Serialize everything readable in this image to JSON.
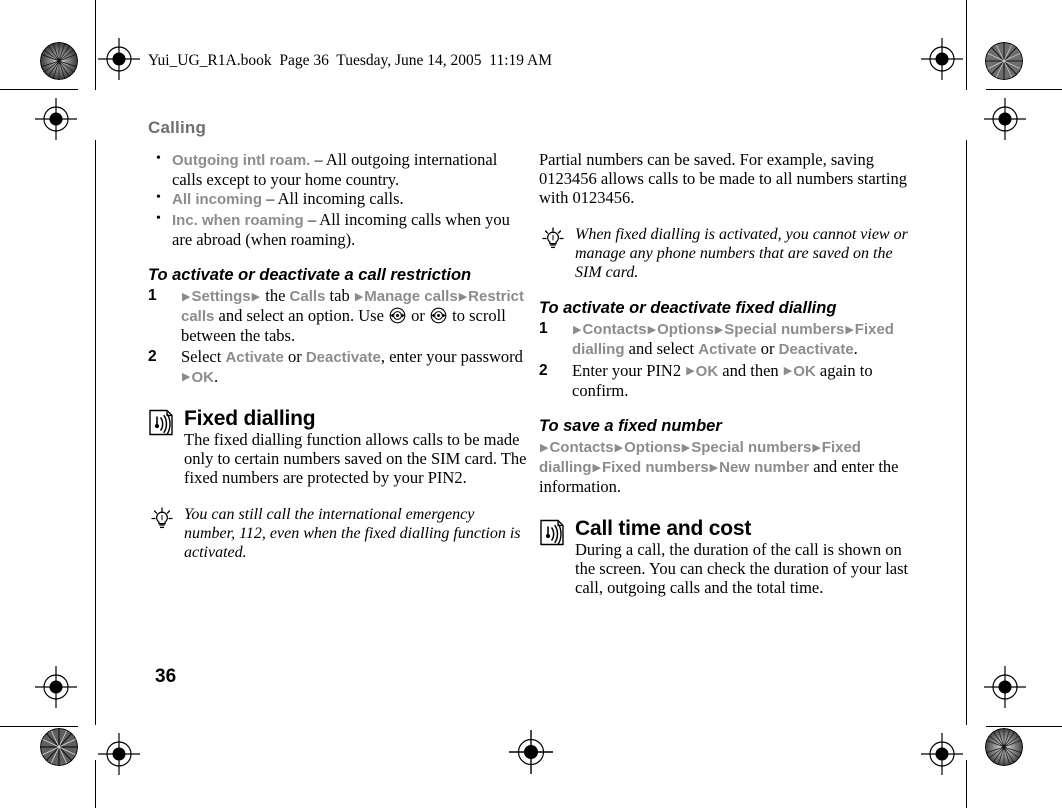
{
  "print": {
    "file_stamp": "Yui_UG_R1A.book  Page 36  Tuesday, June 14, 2005  11:19 AM",
    "folio": "36"
  },
  "chapter": {
    "title": "Calling"
  },
  "left_column": {
    "bullets": [
      {
        "term": "Outgoing intl roam.",
        "dash": " – ",
        "text": "All outgoing international calls except to your home country."
      },
      {
        "term": "All incoming",
        "dash": " – ",
        "text": "All incoming calls."
      },
      {
        "term": "Inc. when roaming",
        "dash": " – ",
        "text": "All incoming calls when you are abroad (when roaming)."
      }
    ],
    "procedure": {
      "heading": "To activate or deactivate a call restriction",
      "steps": [
        {
          "num": "1",
          "parts": [
            {
              "type": "arrow"
            },
            {
              "type": "ui",
              "text": "Settings"
            },
            {
              "type": "arrow"
            },
            {
              "type": "body",
              "text": " the "
            },
            {
              "type": "ui",
              "text": "Calls"
            },
            {
              "type": "body",
              "text": " tab "
            },
            {
              "type": "arrow"
            },
            {
              "type": "ui",
              "text": "Manage calls"
            },
            {
              "type": "arrow"
            },
            {
              "type": "ui",
              "text": "Restrict calls"
            },
            {
              "type": "body",
              "text": " and select an option. Use "
            },
            {
              "type": "navkey",
              "name": "navigation-key-icon"
            },
            {
              "type": "body",
              "text": " or "
            },
            {
              "type": "navkey",
              "name": "navigation-key-icon"
            },
            {
              "type": "body",
              "text": " to scroll between the tabs."
            }
          ]
        },
        {
          "num": "2",
          "parts": [
            {
              "type": "body",
              "text": "Select "
            },
            {
              "type": "ui",
              "text": "Activate"
            },
            {
              "type": "body",
              "text": " or "
            },
            {
              "type": "ui",
              "text": "Deactivate"
            },
            {
              "type": "body",
              "text": ", enter your password "
            },
            {
              "type": "arrow"
            },
            {
              "type": "ui",
              "text": "OK"
            },
            {
              "type": "body",
              "text": "."
            }
          ]
        }
      ]
    },
    "section": {
      "icon": "signal-waves-icon",
      "title": "Fixed dialling",
      "body": "The fixed dialling function allows calls to be made only to certain numbers saved on the SIM card. The fixed numbers are protected by your PIN2."
    },
    "tip": {
      "icon": "lightbulb-icon",
      "text": "You can still call the international emergency number, 112, even when the fixed dialling function is activated."
    }
  },
  "right_column": {
    "intro": "Partial numbers can be saved. For example, saving 0123456 allows calls to be made to all numbers starting with 0123456.",
    "tip": {
      "icon": "lightbulb-icon",
      "text": "When fixed dialling is activated, you cannot view or manage any phone numbers that are saved on the SIM card."
    },
    "procedure": {
      "heading": "To activate or deactivate fixed dialling",
      "steps": [
        {
          "num": "1",
          "parts": [
            {
              "type": "arrow"
            },
            {
              "type": "ui",
              "text": "Contacts"
            },
            {
              "type": "arrow"
            },
            {
              "type": "ui",
              "text": "Options"
            },
            {
              "type": "arrow"
            },
            {
              "type": "ui",
              "text": "Special numbers"
            },
            {
              "type": "arrow"
            },
            {
              "type": "ui",
              "text": "Fixed dialling"
            },
            {
              "type": "body",
              "text": " and select "
            },
            {
              "type": "ui",
              "text": "Activate"
            },
            {
              "type": "body",
              "text": " or "
            },
            {
              "type": "ui",
              "text": "Deactivate"
            },
            {
              "type": "body",
              "text": "."
            }
          ]
        },
        {
          "num": "2",
          "parts": [
            {
              "type": "body",
              "text": "Enter your PIN2 "
            },
            {
              "type": "arrow"
            },
            {
              "type": "ui",
              "text": "OK"
            },
            {
              "type": "body",
              "text": " and then "
            },
            {
              "type": "arrow"
            },
            {
              "type": "ui",
              "text": "OK"
            },
            {
              "type": "body",
              "text": " again to confirm."
            }
          ]
        }
      ]
    },
    "procedure2": {
      "heading": "To save a fixed number",
      "parts": [
        {
          "type": "arrow"
        },
        {
          "type": "ui",
          "text": "Contacts"
        },
        {
          "type": "arrow"
        },
        {
          "type": "ui",
          "text": "Options"
        },
        {
          "type": "arrow"
        },
        {
          "type": "ui",
          "text": "Special numbers"
        },
        {
          "type": "arrow"
        },
        {
          "type": "ui",
          "text": "Fixed dialling"
        },
        {
          "type": "arrow"
        },
        {
          "type": "ui",
          "text": "Fixed numbers"
        },
        {
          "type": "arrow"
        },
        {
          "type": "ui",
          "text": "New number"
        },
        {
          "type": "body",
          "text": " and enter the information."
        }
      ]
    },
    "section": {
      "icon": "signal-waves-icon",
      "title": "Call time and cost",
      "body": "During a call, the duration of the call is shown on the screen. You can check the duration of your last call, outgoing calls and the total time."
    }
  },
  "colors": {
    "ui_term": "#8c8c8c",
    "chapter_title": "#6f6f6f",
    "body_text": "#000000"
  }
}
